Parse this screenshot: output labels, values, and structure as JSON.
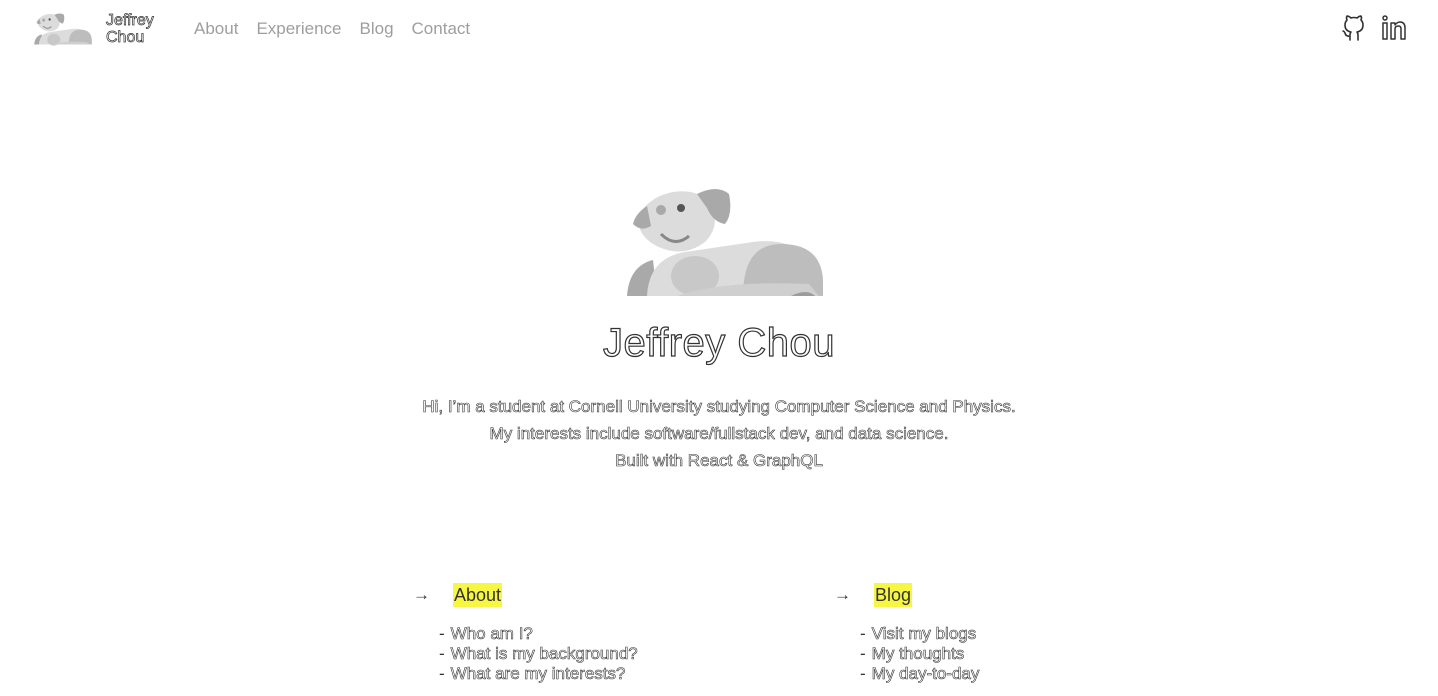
{
  "header": {
    "brand_line1": "Jeffrey",
    "brand_line2": "Chou",
    "nav": [
      "About",
      "Experience",
      "Blog",
      "Contact"
    ],
    "social": [
      "github-icon",
      "linkedin-icon"
    ]
  },
  "hero": {
    "name": "Jeffrey Chou",
    "intro_lines": [
      "Hi, I’m a student at Cornell University studying Computer Science and Physics.",
      "My interests include software/fullstack dev, and data science.",
      "Built with React & GraphQL"
    ]
  },
  "sections": [
    {
      "arrow": "→",
      "title": "About",
      "items": [
        "Who am I?",
        "What is my background?",
        "What are my interests?"
      ]
    },
    {
      "arrow": "→",
      "title": "Blog",
      "items": [
        "Visit my blogs",
        "My thoughts",
        "My day-to-day"
      ]
    }
  ],
  "colors": {
    "highlight": "#f7f743",
    "nav_text": "#9e9e9e",
    "dog_light": "#dcdcdc",
    "dog_dark": "#a9a9a9"
  }
}
